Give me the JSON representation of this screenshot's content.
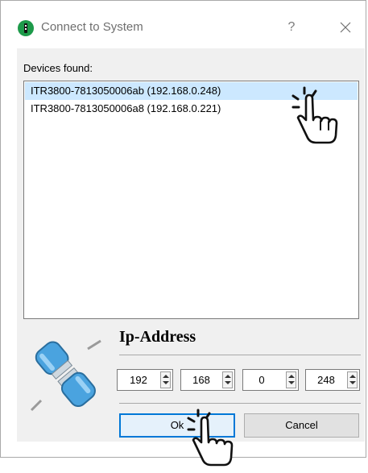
{
  "window": {
    "title": "Connect to System",
    "help_label": "?",
    "icons": {
      "app": "app-logo-icon",
      "close": "close-icon"
    }
  },
  "devices": {
    "caption": "Devices found:",
    "items": [
      {
        "label": "ITR3800-7813050006ab (192.168.0.248)",
        "selected": true
      },
      {
        "label": "ITR3800-7813050006a8 (192.168.0.221)",
        "selected": false
      }
    ]
  },
  "ip": {
    "title": "Ip-Address",
    "octets": [
      "192",
      "168",
      "0",
      "248"
    ]
  },
  "buttons": {
    "ok": "Ok",
    "cancel": "Cancel"
  },
  "colors": {
    "selection": "#cce8ff",
    "default_button_border": "#0078d7",
    "connector_blue": "#4aa3df"
  }
}
